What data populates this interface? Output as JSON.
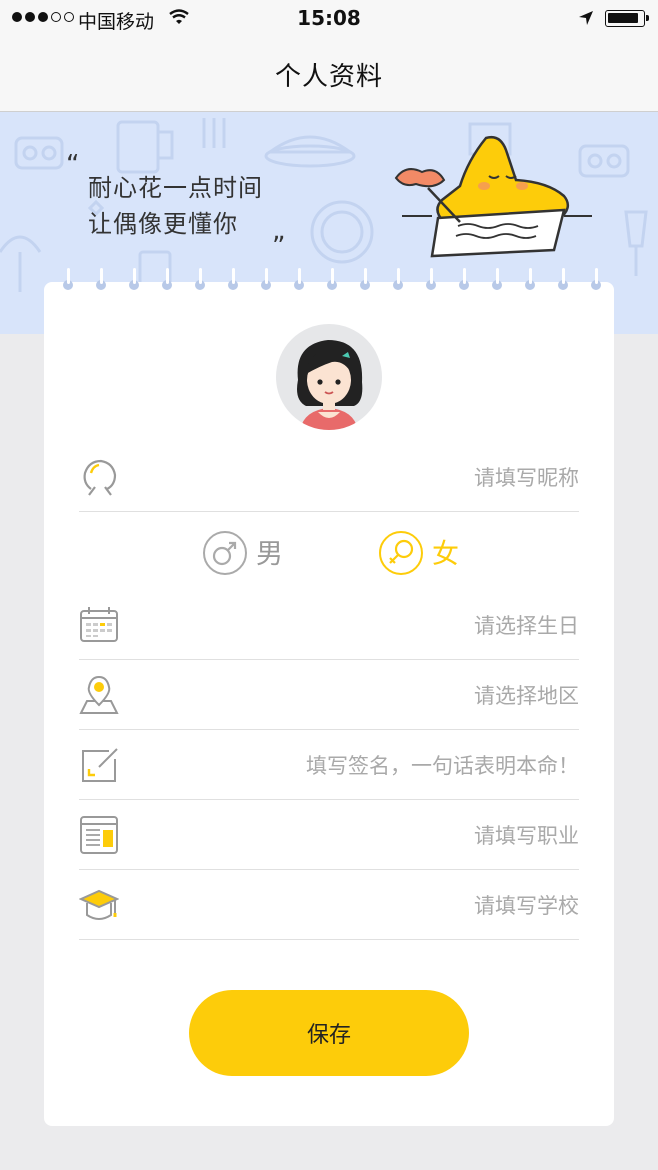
{
  "status_bar": {
    "carrier": "中国移动",
    "time": "15:08"
  },
  "nav": {
    "title": "个人资料"
  },
  "banner": {
    "quote_open": "“",
    "line1": "耐心花一点时间",
    "line2": "让偶像更懂你",
    "quote_close": "„"
  },
  "form": {
    "nickname_placeholder": "请填写昵称",
    "gender": {
      "male_label": "男",
      "female_label": "女",
      "selected": "female"
    },
    "birthday_placeholder": "请选择生日",
    "region_placeholder": "请选择地区",
    "signature_placeholder": "填写签名，一句话表明本命！",
    "occupation_placeholder": "请填写职业",
    "school_placeholder": "请填写学校",
    "save_label": "保存"
  },
  "icons": [
    "signal-dots-icon",
    "wifi-icon",
    "location-arrow-icon",
    "battery-icon",
    "user-head-icon",
    "male-icon",
    "female-icon",
    "calendar-icon",
    "map-pin-icon",
    "edit-note-icon",
    "job-card-icon",
    "graduation-cap-icon"
  ],
  "colors": {
    "accent": "#fdcc0a",
    "banner_bg": "#d8e4fa",
    "page_bg": "#ebebed",
    "placeholder": "#a9a9a9"
  }
}
